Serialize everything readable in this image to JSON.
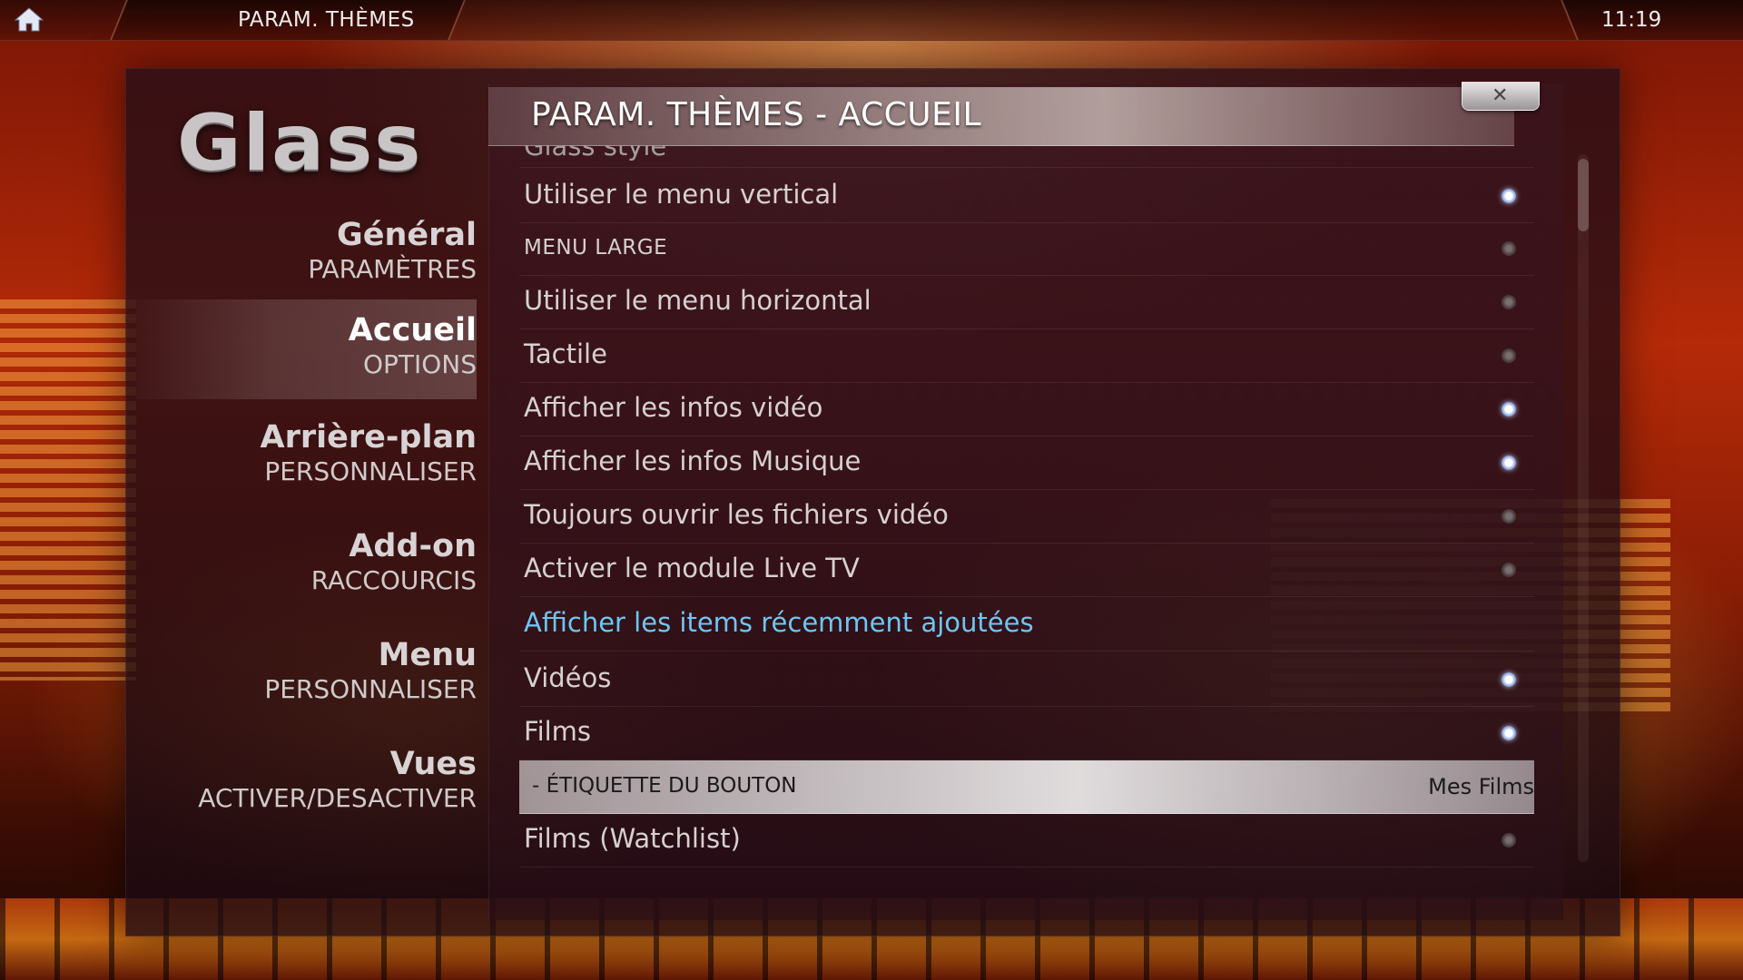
{
  "topbar": {
    "title": "PARAM. THÈMES",
    "clock": "11:19"
  },
  "logo": "Glass",
  "dialog": {
    "title": "PARAM. THÈMES - ACCUEIL",
    "close_icon": "close-icon"
  },
  "sidebar": {
    "items": [
      {
        "title": "Général",
        "subtitle": "PARAMÈTRES",
        "active": false
      },
      {
        "title": "Accueil",
        "subtitle": "OPTIONS",
        "active": true
      },
      {
        "title": "Arrière-plan",
        "subtitle": "PERSONNALISER",
        "active": false
      },
      {
        "title": "Add-on",
        "subtitle": "RACCOURCIS",
        "active": false
      },
      {
        "title": "Menu",
        "subtitle": "PERSONNALISER",
        "active": false
      },
      {
        "title": "Vues",
        "subtitle": "ACTIVER/DESACTIVER",
        "active": false
      }
    ]
  },
  "settings": {
    "rows": [
      {
        "label": "Glass style",
        "kind": "cut"
      },
      {
        "label": "Utiliser le menu vertical",
        "radio": "on"
      },
      {
        "label": "MENU LARGE",
        "kind": "small",
        "radio": "off"
      },
      {
        "label": "Utiliser le menu horizontal",
        "radio": "off"
      },
      {
        "label": "Tactile",
        "radio": "off"
      },
      {
        "label": "Afficher les infos vidéo",
        "radio": "on"
      },
      {
        "label": "Afficher les infos Musique",
        "radio": "on"
      },
      {
        "label": "Toujours ouvrir les fichiers vidéo",
        "radio": "off"
      },
      {
        "label": "Activer le module Live TV",
        "radio": "off"
      },
      {
        "label": "Afficher les items récemment ajoutées",
        "kind": "section"
      },
      {
        "label": "Vidéos",
        "radio": "on"
      },
      {
        "label": "Films",
        "radio": "on"
      },
      {
        "label": "- ÉTIQUETTE DU BOUTON",
        "kind": "focused",
        "value": "Mes Films"
      },
      {
        "label": "Films (Watchlist)",
        "radio": "off"
      }
    ]
  },
  "colors": {
    "section_accent": "#6ec6f2",
    "radio_on": "#c9d9ff"
  },
  "icons": {
    "home": "home-icon",
    "close": "close-icon"
  }
}
